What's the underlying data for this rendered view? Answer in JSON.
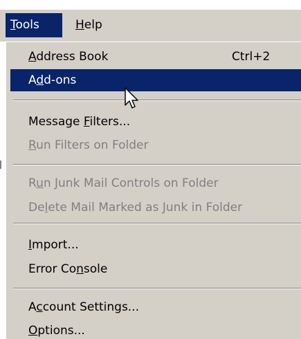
{
  "menubar": {
    "items": [
      {
        "pre": "",
        "key": "T",
        "post": "ools"
      },
      {
        "pre": "",
        "key": "H",
        "post": "elp"
      }
    ]
  },
  "menu": {
    "items": [
      {
        "pre": "",
        "key": "A",
        "post": "ddress Book",
        "shortcut": "Ctrl+2"
      },
      {
        "pre": "A",
        "key": "d",
        "post": "d-ons"
      },
      {
        "pre": "Message ",
        "key": "F",
        "post": "ilters..."
      },
      {
        "pre": "",
        "key": "R",
        "post": "un Filters on Folder"
      },
      {
        "pre": "R",
        "key": "u",
        "post": "n Junk Mail Controls on Folder"
      },
      {
        "pre": "De",
        "key": "l",
        "post": "ete Mail Marked as Junk in Folder"
      },
      {
        "pre": "",
        "key": "I",
        "post": "mport..."
      },
      {
        "pre": "Error Co",
        "key": "n",
        "post": "sole"
      },
      {
        "pre": "A",
        "key": "c",
        "post": "count Settings..."
      },
      {
        "pre": "",
        "key": "O",
        "post": "ptions..."
      }
    ]
  },
  "colors": {
    "highlight": "#0a246a",
    "menu_bg": "#d4d0c8",
    "disabled_text": "#808080"
  },
  "icons": {
    "cursor": "mouse-pointer-icon"
  }
}
